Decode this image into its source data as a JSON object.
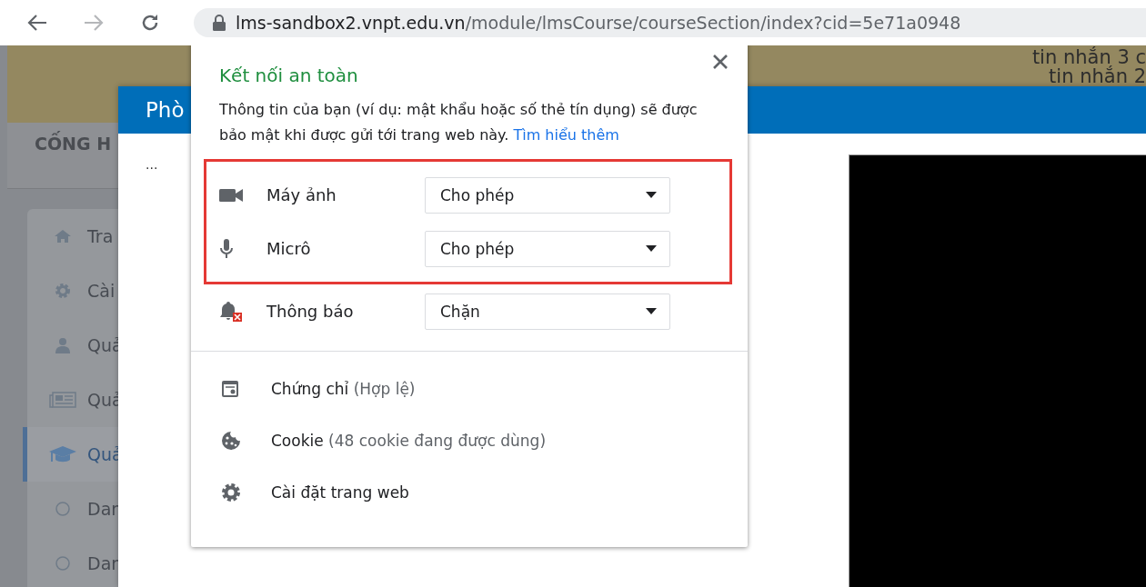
{
  "toolbar": {
    "url_host": "lms-sandbox2.vnpt.edu.vn",
    "url_path": "/module/lmsCourse/courseSection/index?cid=5e71a0948"
  },
  "page": {
    "notices": [
      "tin nhắn 3 c",
      "tin nhắn 2"
    ],
    "site_title": "CỐNG H",
    "sidebar": [
      {
        "kind": "home",
        "label": "Tra",
        "selected": false
      },
      {
        "kind": "gear",
        "label": "Cài",
        "selected": false
      },
      {
        "kind": "user",
        "label": "Quả",
        "selected": false
      },
      {
        "kind": "news",
        "label": "Quả",
        "selected": false
      },
      {
        "kind": "cap",
        "label": "Quả",
        "selected": true
      },
      {
        "kind": "circle",
        "label": "Dan",
        "selected": false
      },
      {
        "kind": "circle",
        "label": "Dan",
        "selected": false
      }
    ]
  },
  "modal": {
    "title": "Phò",
    "body_text": "..."
  },
  "popup": {
    "title": "Kết nối an toàn",
    "description": "Thông tin của bạn (ví dụ: mật khẩu hoặc số thẻ tín dụng) sẽ được bảo mật khi được gửi tới trang web này.",
    "link": "Tìm hiểu thêm",
    "permissions": [
      {
        "kind": "camera",
        "label": "Máy ảnh",
        "value": "Cho phép",
        "highlighted": true
      },
      {
        "kind": "microphone",
        "label": "Micrô",
        "value": "Cho phép",
        "highlighted": true
      },
      {
        "kind": "notifications",
        "label": "Thông báo",
        "value": "Chặn",
        "highlighted": false
      }
    ],
    "entries": [
      {
        "kind": "certificate",
        "label": "Chứng chỉ",
        "detail": "(Hợp lệ)"
      },
      {
        "kind": "cookie",
        "label": "Cookie",
        "detail": "(48 cookie đang được dùng)"
      },
      {
        "kind": "settings",
        "label": "Cài đặt trang web"
      }
    ]
  }
}
